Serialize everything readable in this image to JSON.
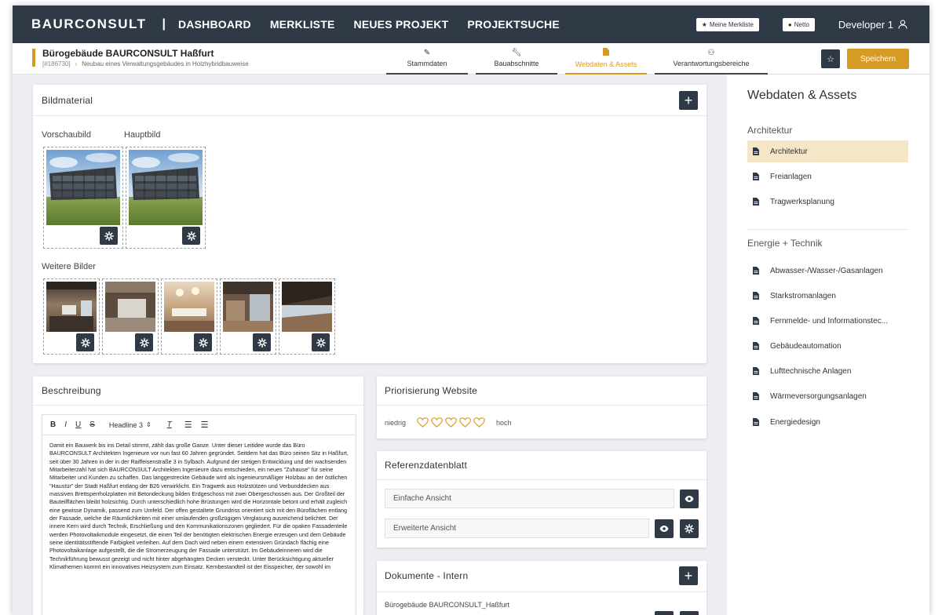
{
  "nav": {
    "brand": "BAURCONSULT",
    "separator": "|",
    "links": [
      "DASHBOARD",
      "MERKLISTE",
      "NEUES PROJEKT",
      "PROJEKTSUCHE"
    ],
    "merkliste_btn": "Meine Merkliste",
    "netto_btn": "Netto",
    "user": "Developer 1"
  },
  "project": {
    "title": "Bürogebäude BAURCONSULT Haßfurt",
    "id": "[#186730]",
    "subtitle": "Neubau eines Verwaltungsgebäudes in Holzhybridbauweise",
    "tabs": [
      "Stammdaten",
      "Bauabschnitte",
      "Webdaten & Assets",
      "Verantwortungsbereiche"
    ],
    "active_tab": "Webdaten & Assets",
    "save_label": "Speichern"
  },
  "bildmaterial": {
    "title": "Bildmaterial",
    "vorschau_label": "Vorschaubild",
    "haupt_label": "Hauptbild",
    "weitere_label": "Weitere Bilder"
  },
  "beschreibung": {
    "title": "Beschreibung",
    "toolbar": {
      "bold": "B",
      "italic": "I",
      "underline": "U",
      "strike": "S",
      "heading": "Headline 3"
    },
    "text": "Damit ein Bauwerk bis ins Detail stimmt, zählt das große Ganze. Unter dieser Leitidee wurde das Büro BAURCONSULT Architekten Ingenieure vor nun fast 60 Jahren gegründet. Seitdem hat das Büro seinen Sitz in Haßfurt, seit über 30 Jahren in der in der Raiffeisenstraße 3 in Sylbach. Aufgrund der stetigen Entwicklung und der wachsenden Mitarbeiterzahl hat sich BAURCONSULT Architekten Ingenieure dazu entschieden, ein neues \"Zuhause\" für seine Mitarbeiter und Kunden zu schaffen. Das langgestreckte Gebäude wird als ingenieursmäßiger Holzbau an der östlichen \"Haustür\" der Stadt Haßfurt entlang der B26 verwirklicht. Ein Tragwerk aus Holzstützen und Verbunddecken aus massiven Brettsperrholzplatten mit Betondeckung bilden Erdgeschoss mit zwei Obergeschossen aus. Der Großteil der Bauteilflächen bleibt holzsichtig. Durch unterschiedlich hohe Brüstungen wird die Horizontale betont und erhält zugleich eine gewisse Dynamik, passend zum Umfeld. Der offen gestaltete Grundriss orientiert sich mit den Büroflächen entlang der Fassade, welche die Räumlichkeiten mit einer umlaufenden großzügigen Verglasung ausreichend belichtet. Der innere Kern wird durch Technik, Erschließung und den Kommunikationszonen gegliedert. Für die opaken Fassadenteile werden Photovoltaikmodule eingesetzt, die einen Teil der benötigten elektrischen Energie erzeugen und dem Gebäude seine identitätsstiftende Farbigkeit verleihen. Auf dem Dach wird neben einem extensiven Gründach flächig eine Photovoltaikanlage aufgestellt, die die Stromerzeugung der Fassade unterstützt. Im Gebäudeinneren wird die Technikführung bewusst gezeigt und nicht hinter abgehängten Decken versteckt. Unter Berücksichtigung aktueller Klimathemen kommt ein innovatives Heizsystem zum Einsatz. Kernbestandteil ist der Eisspeicher, der sowohl im"
  },
  "prio": {
    "title": "Priorisierung Website",
    "low": "niedrig",
    "high": "hoch",
    "max": 5,
    "value": 0,
    "color": "#d79a25"
  },
  "referenz": {
    "title": "Referenzdatenblatt",
    "simple": "Einfache Ansicht",
    "extended": "Erweiterte Ansicht"
  },
  "dokumente": {
    "title": "Dokumente - Intern",
    "first_doc": "Bürogebäude BAURCONSULT_Haßfurt"
  },
  "sidebar": {
    "title": "Webdaten & Assets",
    "sections": [
      {
        "name": "Architektur",
        "items": [
          "Architektur",
          "Freianlagen",
          "Tragwerksplanung"
        ]
      },
      {
        "name": "Energie + Technik",
        "items": [
          "Abwasser-/Wasser-/Gasanlagen",
          "Starkstromanlagen",
          "Fernmelde- und Informationstec...",
          "Gebäudeautomation",
          "Lufttechnische Anlagen",
          "Wärmeversorgungsanlagen",
          "Energiedesign"
        ]
      }
    ],
    "active_item": "Architektur"
  },
  "colors": {
    "dark": "#2f3a46",
    "accent": "#d79a25",
    "active_bg": "#f4e6c7"
  }
}
